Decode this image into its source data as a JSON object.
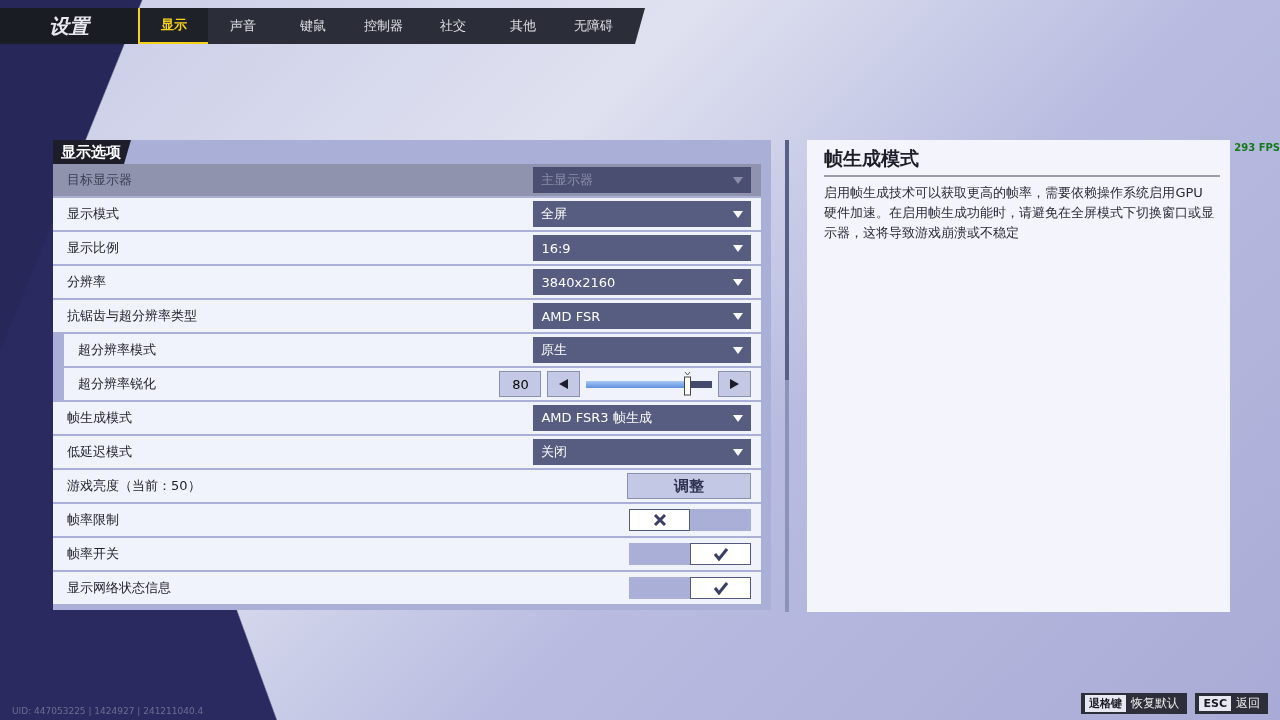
{
  "title": "设置",
  "tabs": [
    {
      "label": "显示",
      "selected": true
    },
    {
      "label": "声音",
      "selected": false
    },
    {
      "label": "键鼠",
      "selected": false
    },
    {
      "label": "控制器",
      "selected": false
    },
    {
      "label": "社交",
      "selected": false
    },
    {
      "label": "其他",
      "selected": false
    },
    {
      "label": "无障碍",
      "selected": false
    }
  ],
  "section_title": "显示选项",
  "settings": [
    {
      "kind": "dropdown",
      "label": "目标显示器",
      "value": "主显示器",
      "disabled": true
    },
    {
      "kind": "dropdown",
      "label": "显示模式",
      "value": "全屏",
      "disabled": false
    },
    {
      "kind": "dropdown",
      "label": "显示比例",
      "value": "16:9",
      "disabled": false
    },
    {
      "kind": "dropdown",
      "label": "分辨率",
      "value": "3840x2160",
      "disabled": false
    },
    {
      "kind": "dropdown",
      "label": "抗锯齿与超分辨率类型",
      "value": "AMD FSR",
      "disabled": false,
      "children": [
        {
          "kind": "dropdown",
          "label": "超分辨率模式",
          "value": "原生",
          "disabled": false
        },
        {
          "kind": "slider",
          "label": "超分辨率锐化",
          "value": "80",
          "level": 0.8
        }
      ]
    },
    {
      "kind": "dropdown",
      "label": "帧生成模式",
      "value": "AMD FSR3 帧生成",
      "disabled": false
    },
    {
      "kind": "dropdown",
      "label": "低延迟模式",
      "value": "关闭",
      "disabled": false
    },
    {
      "kind": "button",
      "label": "游戏亮度（当前：50）",
      "value": "调整"
    },
    {
      "kind": "toggle",
      "label": "帧率限制",
      "checked": false
    },
    {
      "kind": "toggle",
      "label": "帧率开关",
      "checked": true
    },
    {
      "kind": "toggle",
      "label": "显示网络状态信息",
      "checked": true
    }
  ],
  "detail": {
    "title": "帧生成模式",
    "text": "启用帧生成技术可以获取更高的帧率，需要依赖操作系统启用GPU硬件加速。在启用帧生成功能时，请避免在全屏模式下切换窗口或显示器，这将导致游戏崩溃或不稳定"
  },
  "fps": "293 FPS",
  "footer": {
    "uid": "UID: 447053225 | 1424927 | 241211040.4",
    "hints": [
      {
        "key": "退格键",
        "label": "恢复默认"
      },
      {
        "key": "ESC",
        "label": "返回"
      }
    ]
  }
}
